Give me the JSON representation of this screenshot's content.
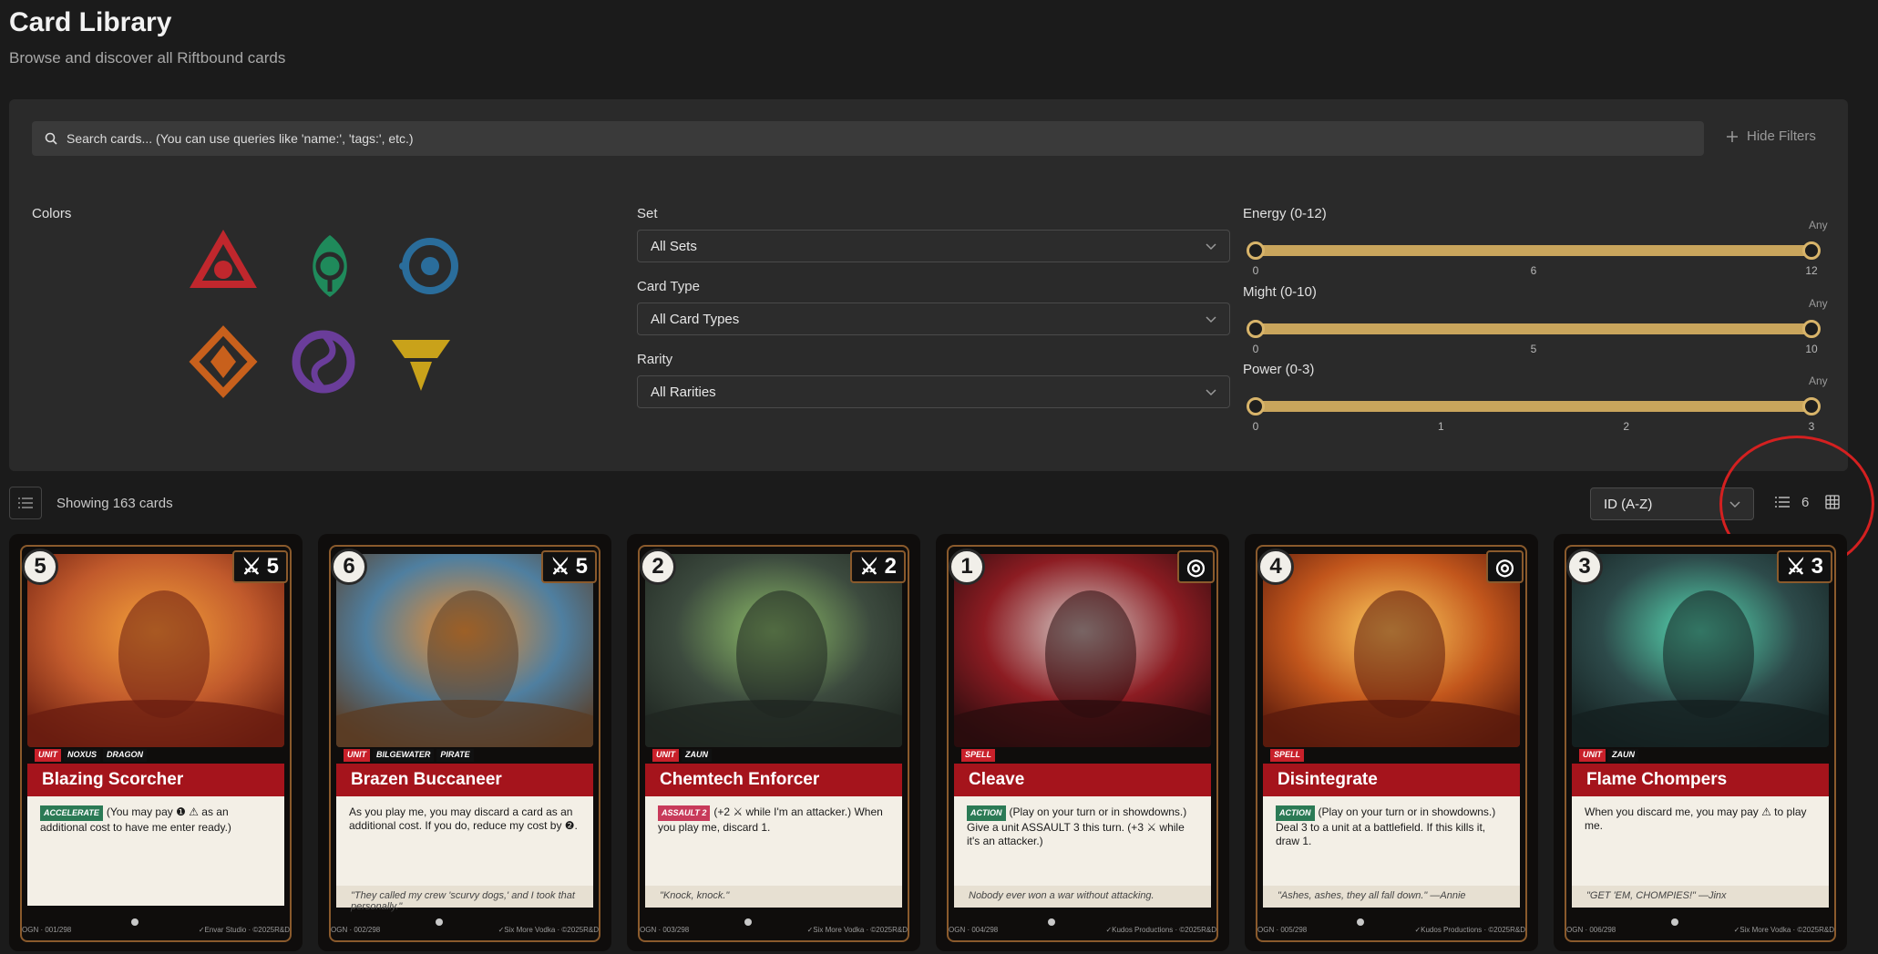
{
  "header": {
    "title": "Card Library",
    "subtitle": "Browse and discover all Riftbound cards"
  },
  "search": {
    "placeholder": "Search cards... (You can use queries like 'name:', 'tags:', etc.)",
    "hide_filters_label": "Hide Filters"
  },
  "filters": {
    "colors_label": "Colors",
    "colors": [
      {
        "name": "fury",
        "hex": "#c0272d"
      },
      {
        "name": "calm",
        "hex": "#1f8a5b"
      },
      {
        "name": "mind",
        "hex": "#2a6d9b"
      },
      {
        "name": "body",
        "hex": "#c8601c"
      },
      {
        "name": "chaos",
        "hex": "#6a3d9a"
      },
      {
        "name": "order",
        "hex": "#c9a21a"
      }
    ],
    "set_label": "Set",
    "set_value": "All Sets",
    "type_label": "Card Type",
    "type_value": "All Card Types",
    "rarity_label": "Rarity",
    "rarity_value": "All Rarities",
    "energy": {
      "label": "Energy (0-12)",
      "any": "Any",
      "ticks": [
        "0",
        "6",
        "12"
      ],
      "min": 0,
      "max": 12
    },
    "might": {
      "label": "Might (0-10)",
      "any": "Any",
      "ticks": [
        "0",
        "5",
        "10"
      ],
      "min": 0,
      "max": 10
    },
    "power": {
      "label": "Power (0-3)",
      "any": "Any",
      "ticks": [
        "0",
        "1",
        "2",
        "3"
      ],
      "min": 0,
      "max": 3
    }
  },
  "toolbar": {
    "showing": "Showing 163 cards",
    "sort_value": "ID (A-Z)",
    "columns": "6"
  },
  "cards": [
    {
      "cost": "5",
      "might": "5",
      "name": "Blazing Scorcher",
      "tags": [
        "UNIT",
        "NOXUS",
        "DRAGON"
      ],
      "keyword": "ACCELERATE",
      "keyword_color": "green",
      "text": "(You may pay ❶ ⚠ as an additional cost to have me enter ready.)",
      "flavor": "",
      "id": "OGN · 001/298",
      "artist": "✓Envar Studio",
      "copyright": "©2025R&D",
      "art": {
        "sky": "#c15a2c",
        "sun": "#f5a23a",
        "fg": "#6a1d10"
      }
    },
    {
      "cost": "6",
      "might": "5",
      "name": "Brazen Buccaneer",
      "tags": [
        "UNIT",
        "BILGEWATER",
        "PIRATE"
      ],
      "keyword": "",
      "keyword_color": "",
      "text": "As you play me, you may discard a card as an additional cost. If you do, reduce my cost by ❷.",
      "flavor": "\"They called my crew 'scurvy dogs,' and I took that personally.\"",
      "id": "OGN · 002/298",
      "artist": "✓Six More Vodka",
      "copyright": "©2025R&D",
      "art": {
        "sky": "#4f7fa0",
        "sun": "#f08c2a",
        "fg": "#5a3c24"
      }
    },
    {
      "cost": "2",
      "might": "2",
      "name": "Chemtech Enforcer",
      "tags": [
        "UNIT",
        "ZAUN"
      ],
      "keyword": "ASSAULT 2",
      "keyword_color": "pink",
      "text": "(+2 ⚔ while I'm an attacker.) When you play me, discard 1.",
      "flavor": "\"Knock, knock.\"",
      "id": "OGN · 003/298",
      "artist": "✓Six More Vodka",
      "copyright": "©2025R&D",
      "art": {
        "sky": "#3c4a3e",
        "sun": "#8fbf6a",
        "fg": "#1f2621"
      }
    },
    {
      "cost": "1",
      "might": "",
      "name": "Cleave",
      "tags": [
        "SPELL"
      ],
      "keyword": "ACTION",
      "keyword_color": "green",
      "text": "(Play on your turn or in showdowns.) Give a unit ASSAULT 3 this turn. (+3 ⚔ while it's an attacker.)",
      "flavor": "Nobody ever won a war without attacking.",
      "id": "OGN · 004/298",
      "artist": "✓Kudos Productions",
      "copyright": "©2025R&D",
      "art": {
        "sky": "#8c1c22",
        "sun": "#d8d0cc",
        "fg": "#2a0c0e"
      }
    },
    {
      "cost": "4",
      "might": "",
      "name": "Disintegrate",
      "tags": [
        "SPELL"
      ],
      "keyword": "ACTION",
      "keyword_color": "green",
      "text": "(Play on your turn or in showdowns.) Deal 3 to a unit at a battlefield. If this kills it, draw 1.",
      "flavor": "\"Ashes, ashes, they all fall down.\" —Annie",
      "id": "OGN · 005/298",
      "artist": "✓Kudos Productions",
      "copyright": "©2025R&D",
      "art": {
        "sky": "#c2561c",
        "sun": "#ffd060",
        "fg": "#5a1a0c"
      }
    },
    {
      "cost": "3",
      "might": "3",
      "name": "Flame Chompers",
      "tags": [
        "UNIT",
        "ZAUN"
      ],
      "keyword": "",
      "keyword_color": "",
      "text": "When you discard me, you may pay ⚠ to play me.",
      "flavor": "\"GET 'EM, CHOMPIES!\" —Jinx",
      "id": "OGN · 006/298",
      "artist": "✓Six More Vodka",
      "copyright": "©2025R&D",
      "art": {
        "sky": "#2d4a4a",
        "sun": "#59e0b8",
        "fg": "#141f1f"
      }
    }
  ]
}
